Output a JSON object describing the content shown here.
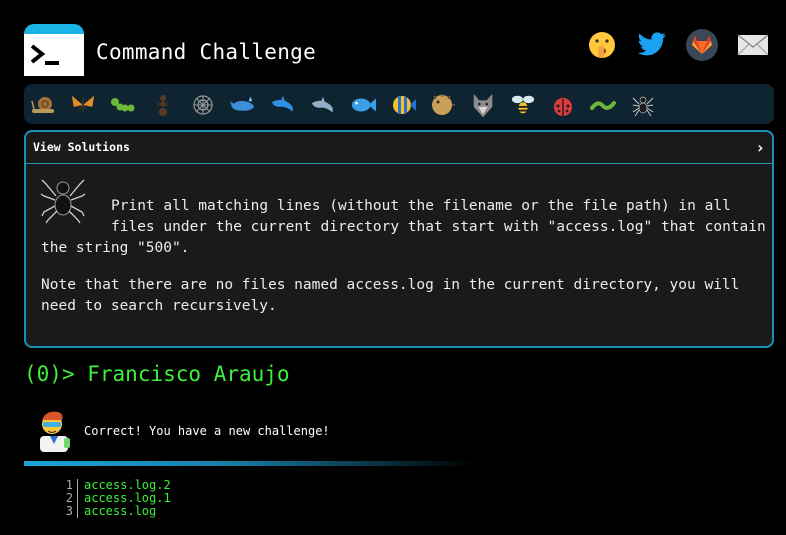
{
  "header": {
    "title": "Command Challenge",
    "social": [
      "shushing-face-icon",
      "twitter-icon",
      "gitlab-icon",
      "mail-icon"
    ]
  },
  "icon_bar": {
    "items": [
      "snail-icon",
      "butterfly-icon",
      "caterpillar-icon",
      "ant-icon",
      "web-icon",
      "whale-icon",
      "dolphin-icon",
      "dolphin-2-icon",
      "fish-icon",
      "tropical-fish-icon",
      "blowfish-icon",
      "wolf-icon",
      "bee-icon",
      "ladybug-icon",
      "worm-icon",
      "spider-icon"
    ]
  },
  "challenge": {
    "view_solutions": "View Solutions",
    "line1": "Print all matching lines (without the filename or the file path) in all",
    "line2": "files under the current directory that start with \"access.log\" that contain",
    "line3": "the string \"500\".",
    "note1": "Note that there are no files named access.log in the current directory, you will",
    "note2": "need to search recursively."
  },
  "user": {
    "score": "(0)",
    "prompt": ">",
    "name": "Francisco Araujo"
  },
  "result": {
    "message": "Correct! You have a new challenge!"
  },
  "output": {
    "lines": [
      {
        "n": "1",
        "text": "access.log.2"
      },
      {
        "n": "2",
        "text": "access.log.1"
      },
      {
        "n": "3",
        "text": "access.log"
      }
    ]
  },
  "colors": {
    "accent": "#1ab5e6",
    "green": "#3df03a",
    "panel_bg": "#1a1a1a",
    "iconbar_bg": "#0e2430"
  }
}
